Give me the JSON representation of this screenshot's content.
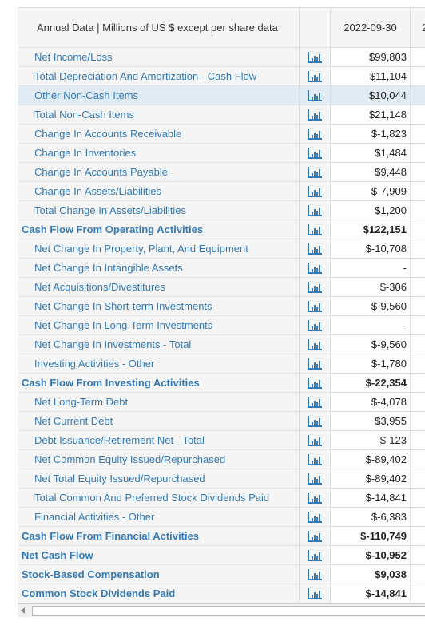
{
  "header": {
    "title": "Annual Data | Millions of US $ except per share data",
    "col1": "2022-09-30",
    "col2": "2"
  },
  "accent": "#337ab7",
  "highlight_row": 2,
  "rows": [
    {
      "label": "Net Income/Loss",
      "value": "$99,803",
      "bold": false
    },
    {
      "label": "Total Depreciation And Amortization - Cash Flow",
      "value": "$11,104",
      "bold": false
    },
    {
      "label": "Other Non-Cash Items",
      "value": "$10,044",
      "bold": false
    },
    {
      "label": "Total Non-Cash Items",
      "value": "$21,148",
      "bold": false
    },
    {
      "label": "Change In Accounts Receivable",
      "value": "$-1,823",
      "bold": false
    },
    {
      "label": "Change In Inventories",
      "value": "$1,484",
      "bold": false
    },
    {
      "label": "Change In Accounts Payable",
      "value": "$9,448",
      "bold": false
    },
    {
      "label": "Change In Assets/Liabilities",
      "value": "$-7,909",
      "bold": false
    },
    {
      "label": "Total Change In Assets/Liabilities",
      "value": "$1,200",
      "bold": false
    },
    {
      "label": "Cash Flow From Operating Activities",
      "value": "$122,151",
      "bold": true
    },
    {
      "label": "Net Change In Property, Plant, And Equipment",
      "value": "$-10,708",
      "bold": false
    },
    {
      "label": "Net Change In Intangible Assets",
      "value": "-",
      "bold": false
    },
    {
      "label": "Net Acquisitions/Divestitures",
      "value": "$-306",
      "bold": false
    },
    {
      "label": "Net Change In Short-term Investments",
      "value": "$-9,560",
      "bold": false
    },
    {
      "label": "Net Change In Long-Term Investments",
      "value": "-",
      "bold": false
    },
    {
      "label": "Net Change In Investments - Total",
      "value": "$-9,560",
      "bold": false
    },
    {
      "label": "Investing Activities - Other",
      "value": "$-1,780",
      "bold": false
    },
    {
      "label": "Cash Flow From Investing Activities",
      "value": "$-22,354",
      "bold": true
    },
    {
      "label": "Net Long-Term Debt",
      "value": "$-4,078",
      "bold": false
    },
    {
      "label": "Net Current Debt",
      "value": "$3,955",
      "bold": false
    },
    {
      "label": "Debt Issuance/Retirement Net - Total",
      "value": "$-123",
      "bold": false
    },
    {
      "label": "Net Common Equity Issued/Repurchased",
      "value": "$-89,402",
      "bold": false
    },
    {
      "label": "Net Total Equity Issued/Repurchased",
      "value": "$-89,402",
      "bold": false
    },
    {
      "label": "Total Common And Preferred Stock Dividends Paid",
      "value": "$-14,841",
      "bold": false
    },
    {
      "label": "Financial Activities - Other",
      "value": "$-6,383",
      "bold": false
    },
    {
      "label": "Cash Flow From Financial Activities",
      "value": "$-110,749",
      "bold": true
    },
    {
      "label": "Net Cash Flow",
      "value": "$-10,952",
      "bold": true
    },
    {
      "label": "Stock-Based Compensation",
      "value": "$9,038",
      "bold": true
    },
    {
      "label": "Common Stock Dividends Paid",
      "value": "$-14,841",
      "bold": true
    }
  ]
}
